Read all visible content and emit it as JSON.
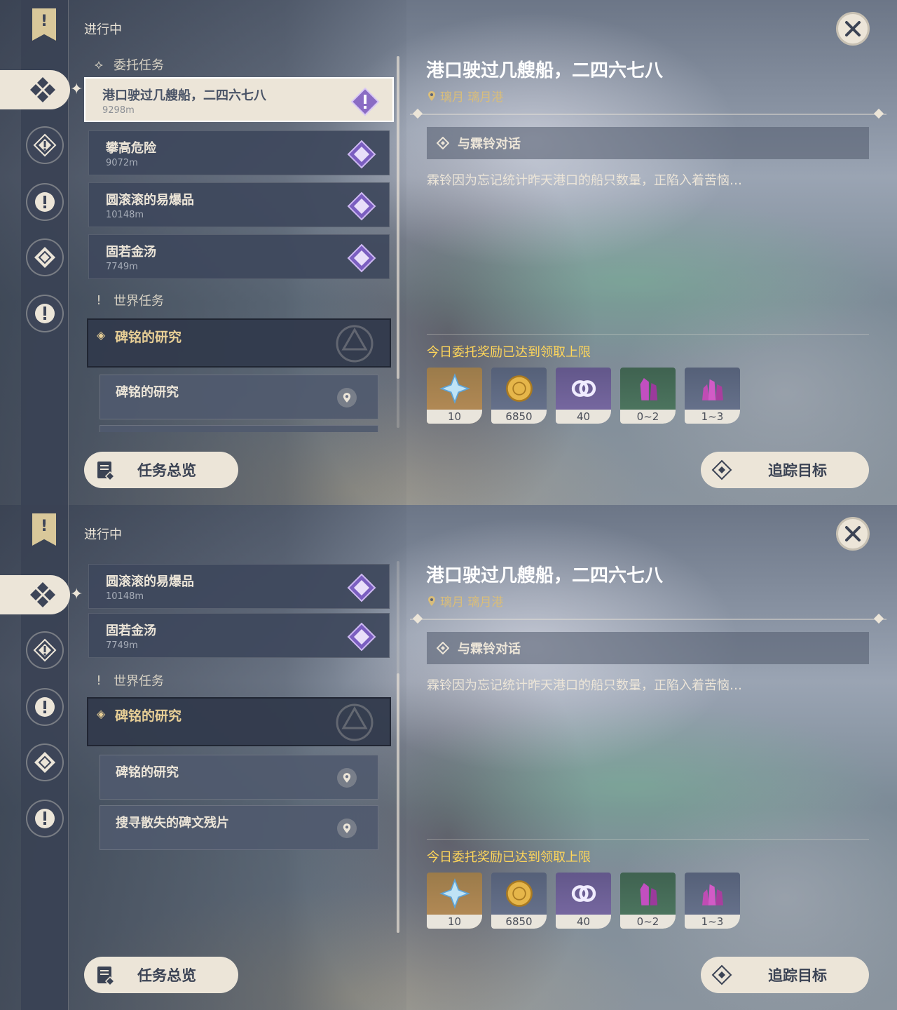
{
  "screens": [
    {
      "status_title": "进行中",
      "sections": {
        "commission": "委托任务",
        "world": "世界任务"
      },
      "commissions": [
        {
          "name": "港口驶过几艘船，二四六七八",
          "distance": "9298m"
        },
        {
          "name": "攀高危险",
          "distance": "9072m"
        },
        {
          "name": "圆滚滚的易爆品",
          "distance": "10148m"
        },
        {
          "name": "固若金汤",
          "distance": "7749m"
        }
      ],
      "world_quest": {
        "title": "碑铭的研究",
        "steps": [
          "碑铭的研究"
        ]
      },
      "detail": {
        "title": "港口驶过几艘船，二四六七八",
        "location": "璃月 璃月港",
        "objective": "与霖铃对话",
        "description": "霖铃因为忘记统计昨天港口的船只数量，正陷入着苦恼…",
        "reward_note": "今日委托奖励已达到领取上限",
        "rewards": [
          {
            "icon": "primogem-icon",
            "count": "10"
          },
          {
            "icon": "mora-icon",
            "count": "6850"
          },
          {
            "icon": "companionship-exp-icon",
            "count": "40"
          },
          {
            "icon": "enhancement-ore-icon",
            "count": "0~2"
          },
          {
            "icon": "crystal-chunk-icon",
            "count": "1~3"
          }
        ]
      },
      "buttons": {
        "overview": "任务总览",
        "track": "追踪目标"
      }
    },
    {
      "status_title": "进行中",
      "sections": {
        "world": "世界任务"
      },
      "commissions": [
        {
          "name": "圆滚滚的易爆品",
          "distance": "10148m"
        },
        {
          "name": "固若金汤",
          "distance": "7749m"
        }
      ],
      "world_quest": {
        "title": "碑铭的研究",
        "steps": [
          "碑铭的研究",
          "搜寻散失的碑文残片"
        ]
      },
      "detail": {
        "title": "港口驶过几艘船，二四六七八",
        "location": "璃月 璃月港",
        "objective": "与霖铃对话",
        "description": "霖铃因为忘记统计昨天港口的船只数量，正陷入着苦恼…",
        "reward_note": "今日委托奖励已达到领取上限",
        "rewards": [
          {
            "icon": "primogem-icon",
            "count": "10"
          },
          {
            "icon": "mora-icon",
            "count": "6850"
          },
          {
            "icon": "companionship-exp-icon",
            "count": "40"
          },
          {
            "icon": "enhancement-ore-icon",
            "count": "0~2"
          },
          {
            "icon": "crystal-chunk-icon",
            "count": "1~3"
          }
        ]
      },
      "buttons": {
        "overview": "任务总览",
        "track": "追踪目标"
      }
    }
  ]
}
